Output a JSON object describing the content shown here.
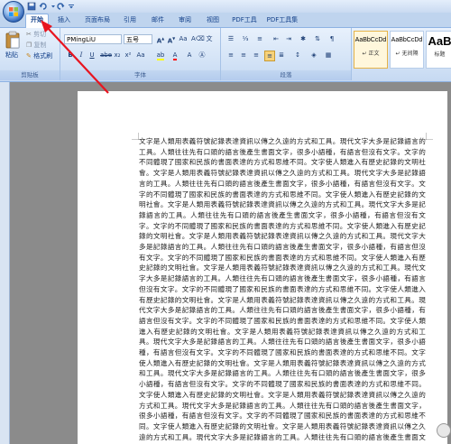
{
  "tabs": [
    "开始",
    "插入",
    "页面布局",
    "引用",
    "邮件",
    "审阅",
    "视图",
    "PDF工具",
    "PDF工具集"
  ],
  "clipboard": {
    "paste_label": "粘贴",
    "cut_label": "剪切",
    "copy_label": "复制",
    "format_painter_label": "格式刷",
    "group_label": "剪贴板"
  },
  "font": {
    "font_name": "PMingLiU",
    "font_size": "五号",
    "group_label": "字体"
  },
  "paragraph": {
    "group_label": "段落"
  },
  "styles": {
    "items": [
      {
        "sample": "AaBbCcDd",
        "name": "↵ 正文"
      },
      {
        "sample": "AaBbCcDd",
        "name": "↵ 无间隔"
      },
      {
        "sample": "AaB",
        "name": "标题"
      }
    ]
  },
  "document": {
    "body": "文字是人類用表義符號記錄表達資訊以傳之久遠的方式和工具。現代文字大多是記錄語言的工具。人類往往先有口頭的語言後產生書面文字，很多小語種，有語言但沒有文字。文字的不同體現了國家和民族的書面表達的方式和思維不同。文字使人類進入有歷史記錄的文明社會。文字是人類用表義符號記錄表達資訊以傳之久遠的方式和工具。現代文字大多是記錄語言的工具。人類往往先有口頭的語言後產生書面文字，很多小語種，有語言但沒有文字。文字的不同體現了國家和民族的書面表達的方式和思維不同。文字使人類進入有歷史記錄的文明社會。文字是人類用表義符號記錄表達資訊以傳之久遠的方式和工具。現代文字大多是記錄語言的工具。人類往往先有口頭的語言後產生書面文字，很多小語種，有語言但沒有文字。文字的不同體現了國家和民族的書面表達的方式和思維不同。文字使人類進入有歷史記錄的文明社會。文字是人類用表義符號記錄表達資訊以傳之久遠的方式和工具。現代文字大多是記錄語言的工具。人類往往先有口頭的語言後產生書面文字，很多小語種，有語言但沒有文字。文字的不同體現了國家和民族的書面表達的方式和思維不同。文字使人類進入有歷史記錄的文明社會。文字是人類用表義符號記錄表達資訊以傳之久遠的方式和工具。現代文字大多是記錄語言的工具。人類往往先有口頭的語言後產生書面文字，很多小語種，有語言但沒有文字。文字的不同體現了國家和民族的書面表達的方式和思維不同。文字使人類進入有歷史記錄的文明社會。文字是人類用表義符號記錄表達資訊以傳之久遠的方式和工具。現代文字大多是記錄語言的工具。人類往往先有口頭的語言後產生書面文字，很多小語種，有語言但沒有文字。文字的不同體現了國家和民族的書面表達的方式和思維不同。文字使人類進入有歷史記錄的文明社會。文字是人類用表義符號記錄表達資訊以傳之久遠的方式和工具。現代文字大多是記錄語言的工具。人類往往先有口頭的語言後產生書面文字，很多小語種，有語言但沒有文字。文字的不同體現了國家和民族的書面表達的方式和思維不同。文字使人類進入有歷史記錄的文明社會。文字是人類用表義符號記錄表達資訊以傳之久遠的方式和工具。現代文字大多是記錄語言的工具。人類往往先有口頭的語言後產生書面文字，很多小語種，有語言但沒有文字。文字的不同體現了國家和民族的書面表達的方式和思維不同。文字使人類進入有歷史記錄的文明社會。文字是人類用表義符號記錄表達資訊以傳之久遠的方式和工具。現代文字大多是記錄語言的工具。人類往往先有口頭的語言後產生書面文字，很多小語種，有語言但沒有文字。文字的不同體現了國家和民族的書面表達的方式和思維不同。文字使人類進入有歷史記錄的文明社會。文字是人類用表義符號記錄表達資訊以傳之久遠的方式和工具。現代文字大多是記錄語言的工具。人類往往先有口頭的語言後產生書面文字，很多小"
  },
  "colors": {
    "annotation_arrow": "#e8141f",
    "highlight": "#ffff00",
    "font_color": "#ff0000"
  },
  "icons": [
    "office-button-icon",
    "save-icon",
    "undo-icon",
    "redo-icon",
    "quick-access-dropdown-icon"
  ]
}
